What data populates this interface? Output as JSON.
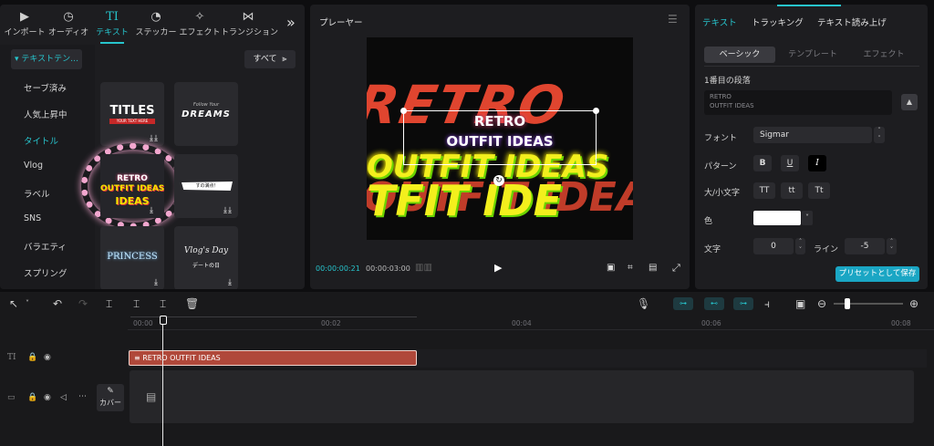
{
  "left_tabs": [
    {
      "label": "インポート",
      "icon": "import-icon",
      "glyph": "▶"
    },
    {
      "label": "オーディオ",
      "icon": "audio-icon",
      "glyph": "♪"
    },
    {
      "label": "テキスト",
      "icon": "text-icon",
      "glyph": "TI"
    },
    {
      "label": "ステッカー",
      "icon": "sticker-icon",
      "glyph": "◔"
    },
    {
      "label": "エフェクト",
      "icon": "effect-icon",
      "glyph": "✧"
    },
    {
      "label": "トランジション",
      "icon": "transition-icon",
      "glyph": "⋈"
    }
  ],
  "more_tabs": "»",
  "categories": {
    "selected": "▾ テキストテン…",
    "items": [
      "セーブ済み",
      "人気上昇中",
      "タイトル",
      "Vlog",
      "ラベル",
      "SNS",
      "バラエティ",
      "スプリング"
    ]
  },
  "filter": {
    "label": "すべて"
  },
  "templates": {
    "titles_text": "TITLES",
    "titles_sub": "YOUR TEXT HERE",
    "dreams_top": "Follow Your",
    "dreams": "DREAMS",
    "retro_l1": "RETRO",
    "retro_l2": "OUTFIT IDEAS",
    "tag": "すの満点！",
    "princess": "PRINCESS",
    "vlog_script": "Vlog's Day",
    "vlog_date": "デートの日"
  },
  "player": {
    "title": "プレーヤー",
    "current_time": "00:00:00:21",
    "total_time": "00:00:03:00",
    "bg_word1": "RETRO",
    "bg_word2": "OUTFIT IDEAS",
    "overlay_l1": "RETRO",
    "overlay_l2": "OUTFIT IDEAS"
  },
  "inspector": {
    "tabs": [
      "テキスト",
      "トラッキング",
      "テキスト読み上げ"
    ],
    "subtabs": [
      "ベーシック",
      "テンプレート",
      "エフェクト"
    ],
    "paragraph_label": "1番目の段落",
    "text_line1": "RETRO",
    "text_line2": "OUTFIT IDEAS",
    "font_label": "フォント",
    "font_value": "Sigmar",
    "pattern_label": "パターン",
    "pattern_bold": "B",
    "pattern_underline": "U",
    "pattern_italic": "I",
    "case_label": "大/小文字",
    "case_options": [
      "TT",
      "tt",
      "Tt"
    ],
    "color_label": "色",
    "color_value": "#ffffff",
    "char_label": "文字",
    "char_value": "0",
    "line_label": "ライン",
    "line_value": "-5",
    "preset_button": "プリセットとして保存"
  },
  "timeline": {
    "ticks": [
      "00:00",
      "00:02",
      "00:04",
      "00:06",
      "00:08"
    ],
    "text_clip": "RETRO OUTFIT IDEAS",
    "cover_label": "カバー"
  },
  "colors": {
    "accent": "#27c4cc",
    "clip": "#b0483a",
    "preset_btn": "#1aa6c4"
  }
}
